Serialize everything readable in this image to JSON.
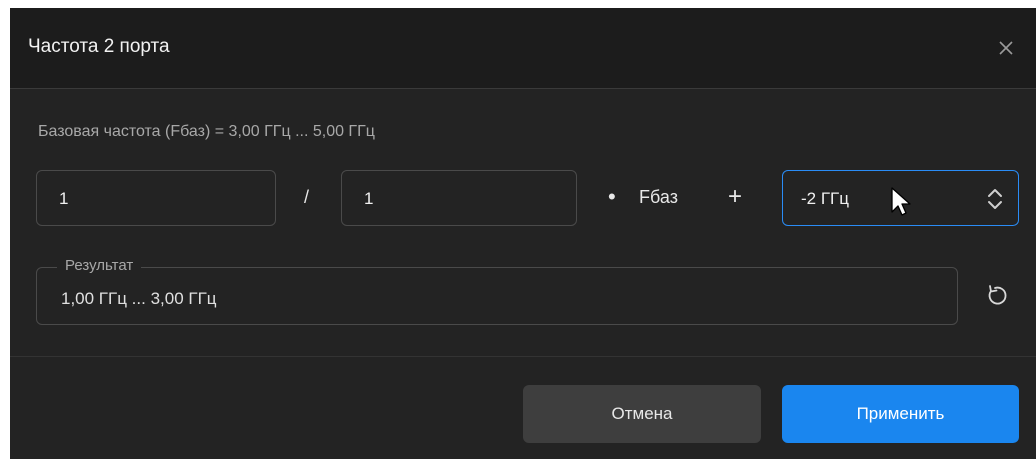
{
  "dialog": {
    "title": "Частота 2 порта",
    "base_frequency": "Базовая частота (Fбаз) = 3,00 ГГц ... 5,00 ГГц",
    "numerator": "1",
    "slash": "/",
    "denominator": "1",
    "multiply": "•",
    "base_symbol": "Fбаз",
    "plus": "+",
    "offset": "-2 ГГц",
    "result_label": "Результат",
    "result_value": "1,00 ГГц ... 3,00 ГГц",
    "cancel_label": "Отмена",
    "apply_label": "Применить"
  },
  "icons": {
    "close": "close-icon",
    "stepper": "up-down-chevron-icon",
    "reset": "reset-icon",
    "cursor": "mouse-pointer-icon"
  },
  "colors": {
    "background": "#232323",
    "titlebar": "#1c1c1c",
    "accent": "#1a86ef",
    "focus_border": "#2a8cf5",
    "cancel_bg": "#3e3e3e"
  }
}
